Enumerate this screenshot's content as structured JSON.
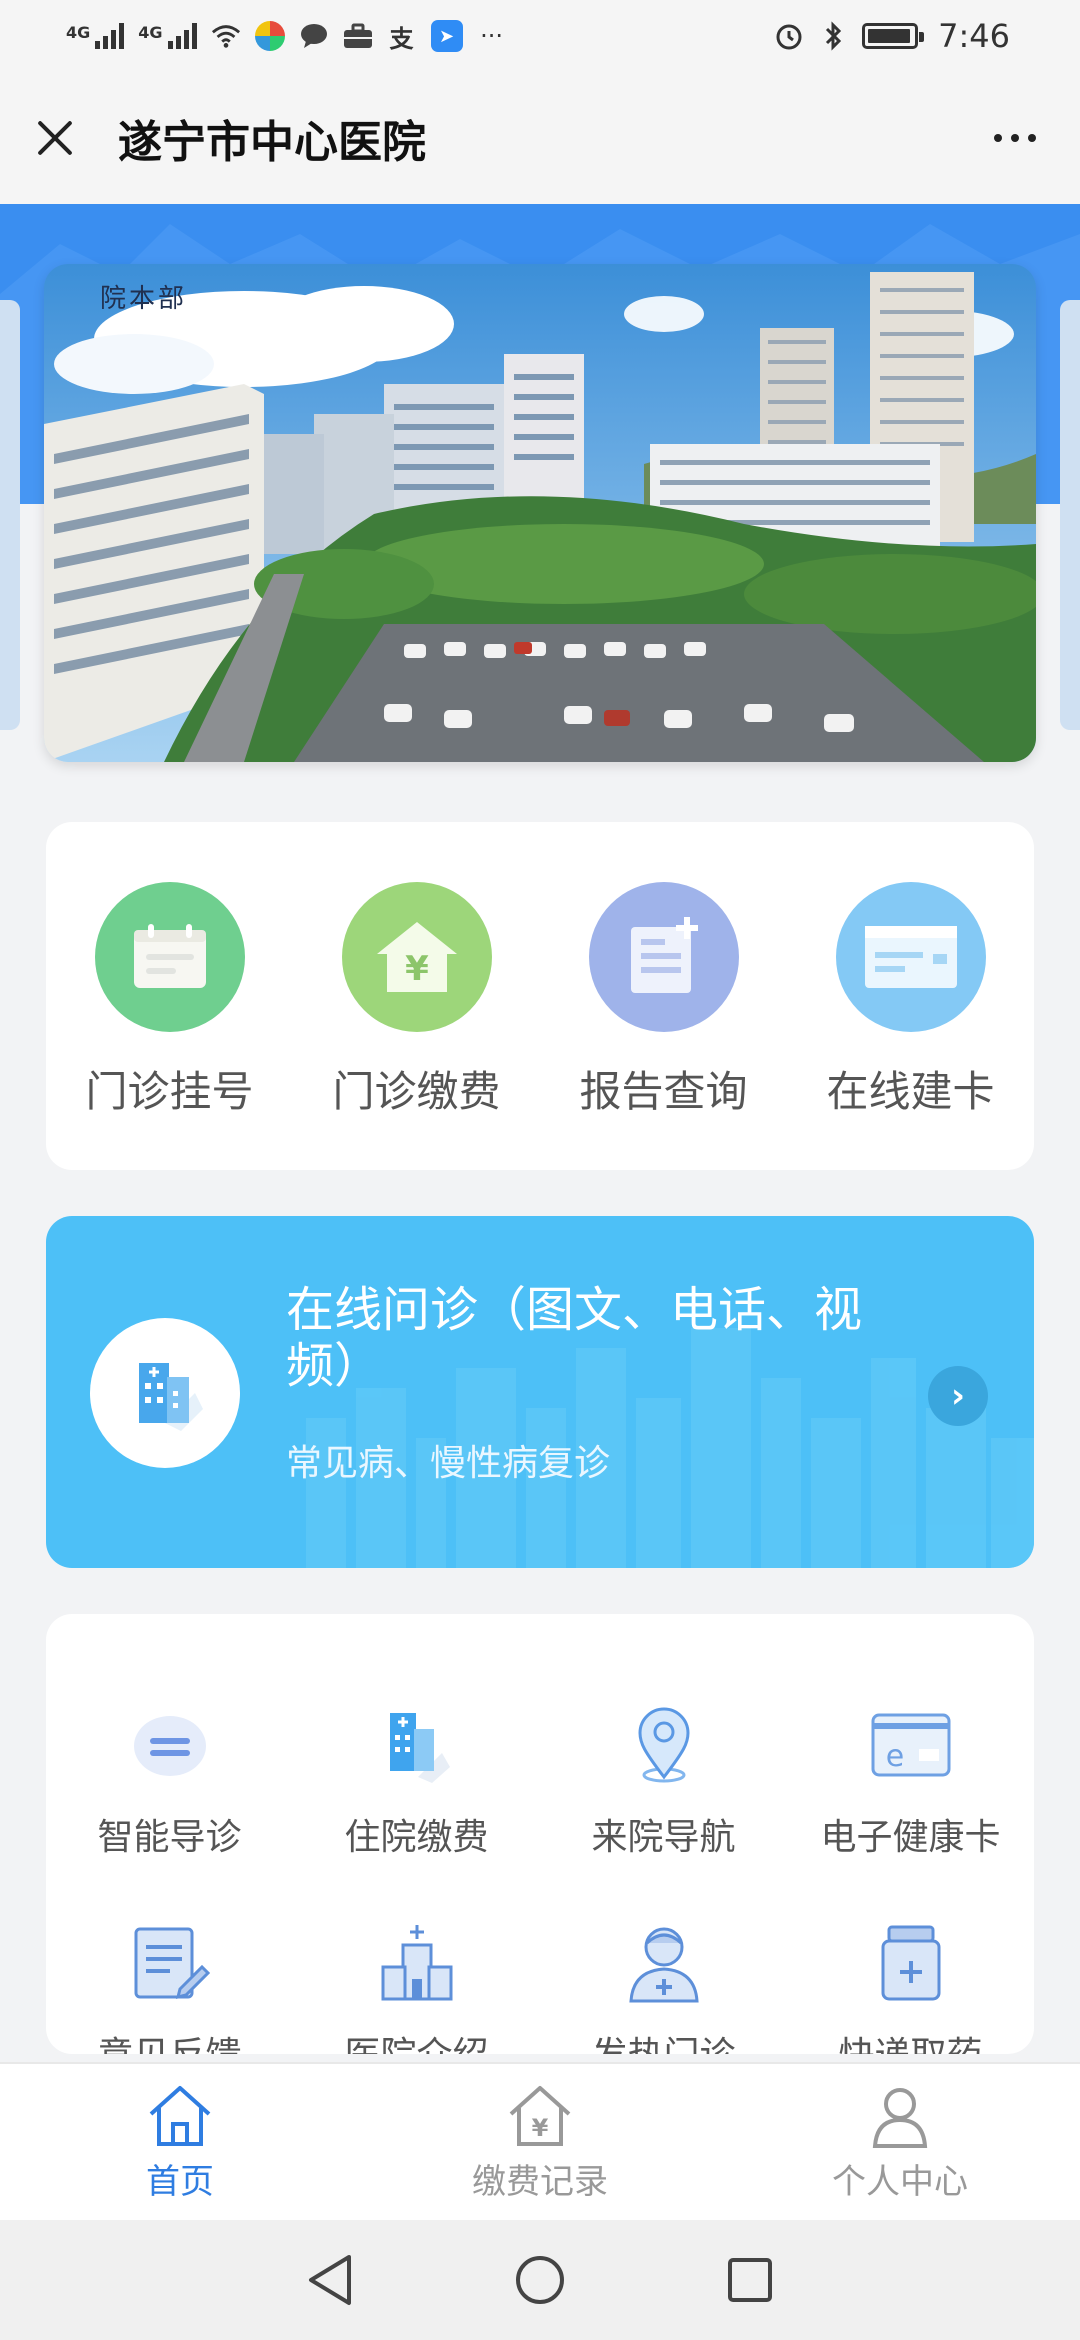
{
  "status_bar": {
    "network_1": "4G",
    "network_2": "4G",
    "time": "7:46",
    "icons": [
      "signal-icon",
      "wifi-icon",
      "app-icon",
      "chat-icon",
      "briefcase-icon",
      "alipay-icon",
      "app-icon",
      "alarm-icon",
      "bluetooth-icon",
      "battery-icon"
    ]
  },
  "header": {
    "title": "遂宁市中心医院",
    "close_icon": "close-icon",
    "more_icon": "more-icon"
  },
  "banner": {
    "caption": "院本部"
  },
  "quick_services": [
    {
      "label": "门诊挂号",
      "icon": "calendar-icon",
      "color": "#6fcf8f"
    },
    {
      "label": "门诊缴费",
      "icon": "yuan-house-icon",
      "color": "#9dd67a"
    },
    {
      "label": "报告查询",
      "icon": "report-icon",
      "color": "#9fb3ea"
    },
    {
      "label": "在线建卡",
      "icon": "card-icon",
      "color": "#84c9f5"
    }
  ],
  "consult": {
    "title": "在线问诊（图文、电话、视频）",
    "subtitle": "常见病、慢性病复诊"
  },
  "services": [
    {
      "label": "智能导诊",
      "icon": "menu-icon"
    },
    {
      "label": "住院缴费",
      "icon": "hospital-building-icon"
    },
    {
      "label": "来院导航",
      "icon": "location-pin-icon"
    },
    {
      "label": "电子健康卡",
      "icon": "e-card-icon"
    },
    {
      "label": "意见反馈",
      "icon": "feedback-icon"
    },
    {
      "label": "医院介绍",
      "icon": "hospital-icon"
    },
    {
      "label": "发热门诊",
      "icon": "doctor-icon"
    },
    {
      "label": "快递取药",
      "icon": "medicine-bottle-icon"
    }
  ],
  "tabbar": [
    {
      "label": "首页",
      "icon": "home-icon",
      "active": true
    },
    {
      "label": "缴费记录",
      "icon": "payment-house-icon",
      "active": false
    },
    {
      "label": "个人中心",
      "icon": "user-icon",
      "active": false
    }
  ],
  "colors": {
    "primary_blue": "#3a8ef0",
    "consult_blue": "#4dc0f7",
    "active_tab": "#2f7de1"
  }
}
